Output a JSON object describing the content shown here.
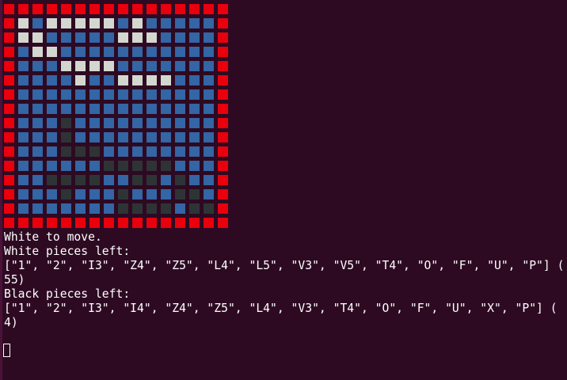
{
  "terminal": {
    "background": "#2d0a22",
    "text_color": "#ffffff"
  },
  "board": {
    "rows": 16,
    "cols": 16,
    "legend": {
      "R": "border",
      "B": "empty",
      "W": "white-piece",
      "K": "black-piece"
    },
    "colors": {
      "R": "#e8000d",
      "B": "#3465a4",
      "W": "#d3d7cf",
      "K": "#2e3436"
    },
    "grid": [
      "RRRRRRRRRRRRRRRR",
      "RWBWWWWWBWBBBBBR",
      "RWWBBBBBWWWBBBBR",
      "RBWWBBBBBBBBBBBR",
      "RBBBWWWWBBBBBBBR",
      "RBBBBWBBWWWWBBBR",
      "RBBBBBBBBBBBBBBR",
      "RBBBBBBBBBBBBBBR",
      "RBBBKBBBBBBBBBBR",
      "RBBBKBBBBBBBBBBR",
      "RBBBKKKBBBBBBBBR",
      "RBBBBBBKKKKKBBBR",
      "RBBKKKKBBKKBKBBR",
      "RBBBKBBBKBBBKKBR",
      "RBBBBBBBKKKKBKKR",
      "RRRRRRRRRRRRRRRR"
    ]
  },
  "output": {
    "status": "White to move.",
    "white_header": "White pieces left:",
    "white_list": "[\"1\", \"2\", \"I3\", \"Z4\", \"Z5\", \"L4\", \"L5\", \"V3\", \"V5\", \"T4\", \"O\", \"F\", \"U\", \"P\"] (",
    "white_count": "55)",
    "black_header": "Black pieces left:",
    "black_list": "[\"1\", \"2\", \"I3\", \"I4\", \"Z4\", \"Z5\", \"L4\", \"V3\", \"T4\", \"O\", \"F\", \"U\", \"X\", \"P\"] (",
    "black_count": "4)"
  }
}
